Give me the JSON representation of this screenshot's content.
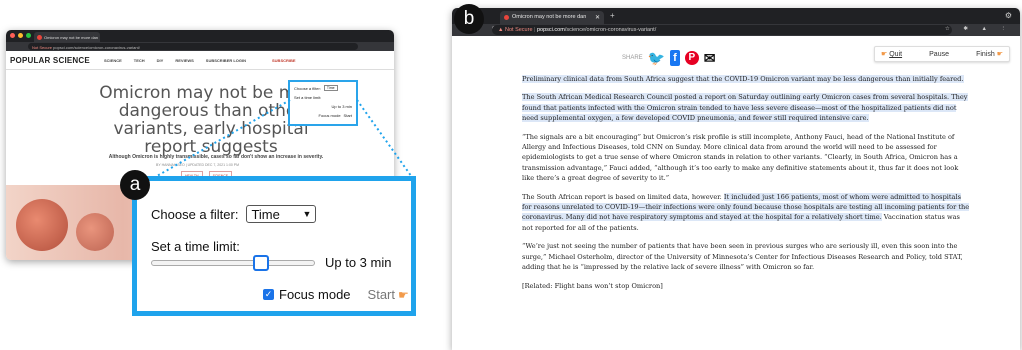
{
  "panel_a": {
    "label": "a",
    "tab_title": "Omicron may not be more dan",
    "url": {
      "secure": "Not Secure",
      "address": "popsci.com/science/omicron-coronavirus-variant/"
    },
    "site_logo": "POPULAR SCIENCE",
    "nav_links": [
      "SCIENCE",
      "TECH",
      "DIY",
      "REVIEWS",
      "SUBSCRIBER LOGIN"
    ],
    "subscribe": "SUBSCRIBE",
    "headline": "Omicron may not be more dangerous than other variants, early hospital report suggests",
    "subheadline": "Although Omicron is highly transmissible, cases so far don't show an increase in severity.",
    "byline": "BY HANNAH SEO | UPDATED DEC 7, 2021 1:00 PM",
    "buttons": [
      "HEALTH",
      "SCIENCE"
    ],
    "filter": {
      "choose_label": "Choose a filter:",
      "selected": "Time",
      "time_label": "Set a time limit:",
      "slider_fraction": 0.68,
      "range_text": "Up to 3 min",
      "focus_label": "Focus mode",
      "focus_checked": true,
      "start_label": "Start"
    }
  },
  "panel_b": {
    "label": "b",
    "tab_title": "Omicron may not be more dan",
    "url": {
      "secure": "Not Secure",
      "domain": "popsci.com",
      "path": "/science/omicron-coronavirus-variant/"
    },
    "share_label": "SHARE",
    "controls": {
      "quit": "Quit",
      "pause": "Pause",
      "finish": "Finish"
    },
    "paragraphs": [
      {
        "parts": [
          {
            "t": "Preliminary clinical data from South Africa suggest that the COVID-19 Omicron variant may be less dangerous than initially feared.",
            "h": true
          }
        ]
      },
      {
        "parts": [
          {
            "t": "The South African Medical Research Council posted a report on Saturday outlining early Omicron cases from several hospitals. They found that patients infected with the Omicron strain tended to have less severe disease—most of the hospitalized patients did not need supplemental oxygen, a few developed COVID pneumonia, and fewer still required intensive care.",
            "h": true
          }
        ]
      },
      {
        "parts": [
          {
            "t": "“The signals are a bit encouraging” but Omicron’s risk profile is still incomplete, Anthony Fauci, head of the National Institute of Allergy and Infectious Diseases, told CNN on Sunday. More clinical data from around the world will need to be assessed for epidemiologists to get a true sense of where Omicron stands in relation to other variants. “Clearly, in South Africa, Omicron has a transmission advantage,” Fauci added, “although it’s too early to make any definitive statements about it, thus far it does not look like there’s a great degree of severity to it.”",
            "h": false
          }
        ]
      },
      {
        "parts": [
          {
            "t": "The South African report is based on limited data, however. ",
            "h": false
          },
          {
            "t": "It included just 166 patients, most of whom were admitted to hospitals for reasons unrelated to COVID-19—their infections were only found because those hospitals are testing all incoming patients for the coronavirus. Many did not have respiratory symptoms and stayed at the hospital for a relatively short time.",
            "h": true
          },
          {
            "t": " Vaccination status was not reported for all of the patients.",
            "h": false
          }
        ]
      },
      {
        "parts": [
          {
            "t": "“We’re just not seeing the number of patients that have been seen in previous surges who are seriously ill, even this soon into the surge,” Michael Osterholm, director of the University of Minnesota’s Center for Infectious Diseases Research and Policy, told STAT, adding that he is “impressed by the relative lack of severe illness” with Omicron so far.",
            "h": false
          }
        ]
      },
      {
        "parts": [
          {
            "t": "[Related: Flight bans won’t stop Omicron]",
            "h": false
          }
        ]
      }
    ]
  }
}
